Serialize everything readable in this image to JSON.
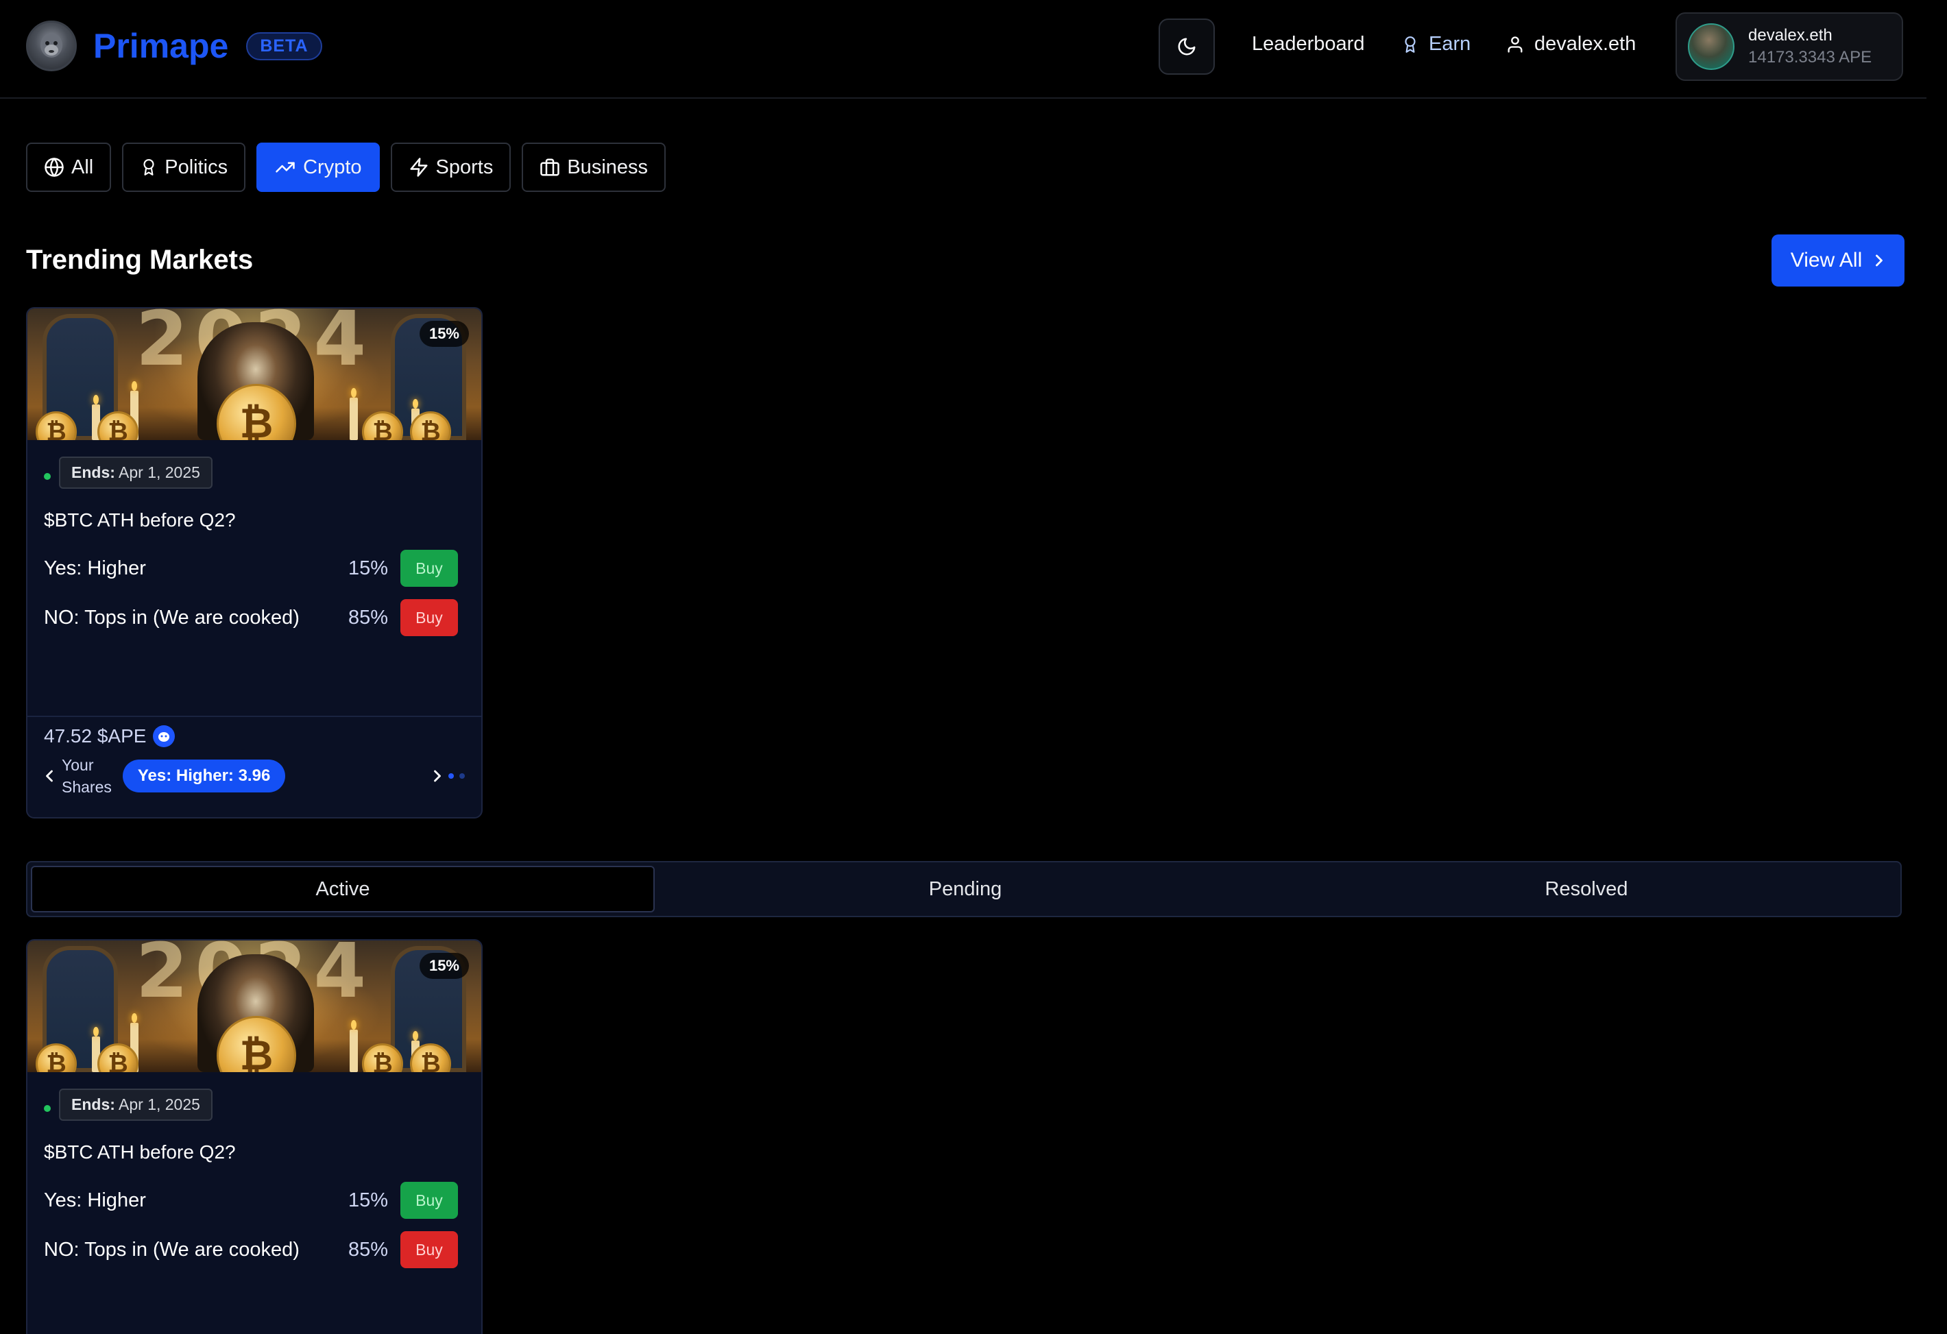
{
  "brand": {
    "name": "Primape",
    "badge": "BETA"
  },
  "header": {
    "nav": [
      {
        "label": "Leaderboard",
        "icon": ""
      },
      {
        "label": "Earn",
        "icon": "award-icon"
      },
      {
        "label": "devalex.eth",
        "icon": "user-icon"
      }
    ],
    "profile": {
      "name": "devalex.eth",
      "balance": "14173.3343 APE"
    }
  },
  "categories": [
    {
      "label": "All",
      "icon": "globe-icon",
      "active": false
    },
    {
      "label": "Politics",
      "icon": "award-icon",
      "active": false
    },
    {
      "label": "Crypto",
      "icon": "trending-up-icon",
      "active": true
    },
    {
      "label": "Sports",
      "icon": "zap-icon",
      "active": false
    },
    {
      "label": "Business",
      "icon": "briefcase-icon",
      "active": false
    }
  ],
  "trending": {
    "title": "Trending Markets",
    "view_all": "View All"
  },
  "markets": [
    {
      "image_year": "2024",
      "badge": "15%",
      "ends_label": "Ends:",
      "ends_date": "Apr 1, 2025",
      "question": "$BTC ATH before Q2?",
      "outcomes": [
        {
          "label": "Yes: Higher",
          "pct": "15%",
          "action": "Buy"
        },
        {
          "label": "NO: Tops in (We are cooked)",
          "pct": "85%",
          "action": "Buy"
        }
      ],
      "amount": "47.52 $APE",
      "shares_label_1": "Your",
      "shares_label_2": "Shares",
      "shares_pill": "Yes: Higher: 3.96"
    },
    {
      "image_year": "2024",
      "badge": "15%",
      "ends_label": "Ends:",
      "ends_date": "Apr 1, 2025",
      "question": "$BTC ATH before Q2?",
      "outcomes": [
        {
          "label": "Yes: Higher",
          "pct": "15%",
          "action": "Buy"
        },
        {
          "label": "NO: Tops in (We are cooked)",
          "pct": "85%",
          "action": "Buy"
        }
      ]
    }
  ],
  "status_tabs": [
    {
      "label": "Active",
      "active": true
    },
    {
      "label": "Pending",
      "active": false
    },
    {
      "label": "Resolved",
      "active": false
    }
  ],
  "colors": {
    "accent": "#1450f5",
    "yes": "#16a34a",
    "no": "#dc2626",
    "bg": "#000000",
    "card": "#0a1024"
  }
}
